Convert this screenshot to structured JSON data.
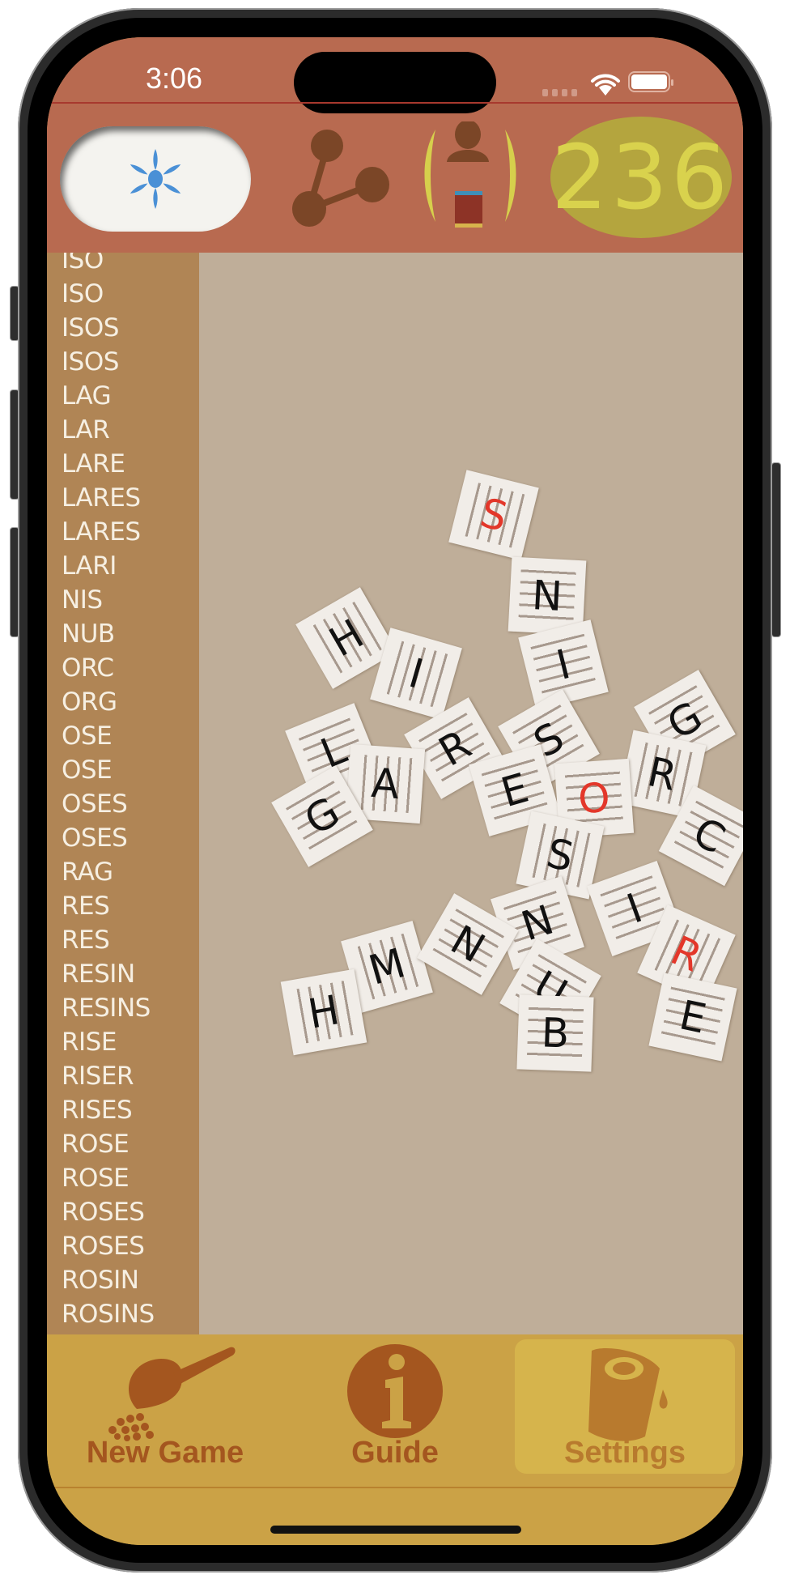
{
  "status_bar": {
    "time": "3:06"
  },
  "header": {
    "hint_button": {
      "icon": "sparkle-icon"
    },
    "share_button": {
      "icon": "share-icon"
    },
    "player_button": {
      "icon": "player-icon"
    },
    "score": "236"
  },
  "word_list": [
    "ISO",
    "ISO",
    "ISOS",
    "ISOS",
    "LAG",
    "LAR",
    "LARE",
    "LARES",
    "LARES",
    "LARI",
    "NIS",
    "NUB",
    "ORC",
    "ORG",
    "OSE",
    "OSE",
    "OSES",
    "OSES",
    "RAG",
    "RES",
    "RES",
    "RESIN",
    "RESINS",
    "RISE",
    "RISER",
    "RISES",
    "ROSE",
    "ROSE",
    "ROSES",
    "ROSES",
    "ROSIN",
    "ROSINS"
  ],
  "board": {
    "tiles": [
      {
        "letter": "S",
        "highlight": true
      },
      {
        "letter": "N",
        "highlight": false
      },
      {
        "letter": "I",
        "highlight": false
      },
      {
        "letter": "H",
        "highlight": false
      },
      {
        "letter": "I",
        "highlight": false
      },
      {
        "letter": "G",
        "highlight": false
      },
      {
        "letter": "L",
        "highlight": false
      },
      {
        "letter": "R",
        "highlight": false
      },
      {
        "letter": "S",
        "highlight": false
      },
      {
        "letter": "A",
        "highlight": false
      },
      {
        "letter": "E",
        "highlight": false
      },
      {
        "letter": "R",
        "highlight": false
      },
      {
        "letter": "O",
        "highlight": true
      },
      {
        "letter": "G",
        "highlight": false
      },
      {
        "letter": "C",
        "highlight": false
      },
      {
        "letter": "S",
        "highlight": false
      },
      {
        "letter": "I",
        "highlight": false
      },
      {
        "letter": "N",
        "highlight": false
      },
      {
        "letter": "M",
        "highlight": false
      },
      {
        "letter": "N",
        "highlight": false
      },
      {
        "letter": "R",
        "highlight": true
      },
      {
        "letter": "U",
        "highlight": false
      },
      {
        "letter": "H",
        "highlight": false
      },
      {
        "letter": "E",
        "highlight": false
      },
      {
        "letter": "B",
        "highlight": false
      }
    ]
  },
  "tabbar": {
    "tabs": [
      {
        "label": "New Game",
        "icon": "scoop-icon",
        "active": false
      },
      {
        "label": "Guide",
        "icon": "info-icon",
        "active": false
      },
      {
        "label": "Settings",
        "icon": "cup-icon",
        "active": true
      }
    ]
  },
  "colors": {
    "header_bg": "#b86a50",
    "word_list_bg": "#b08555",
    "board_bg": "#bfae99",
    "tabbar_bg": "#cba246",
    "score_badge": "#b4a53e",
    "score_text": "#d9d24d",
    "highlight_letter": "#e3372a",
    "hint_icon": "#4a90d6"
  }
}
